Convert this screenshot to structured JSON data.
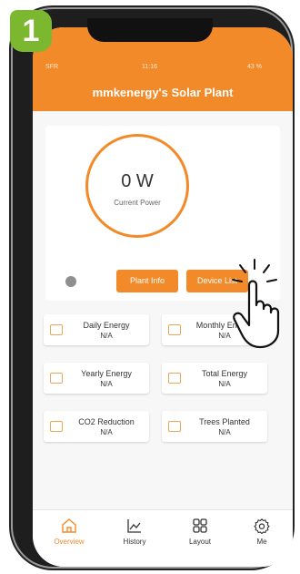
{
  "step_number": "1",
  "status_bar": {
    "carrier": "SFR",
    "time": "11:16",
    "battery": "43 %"
  },
  "app": {
    "title": "mmkenergy's Solar Plant"
  },
  "power": {
    "value": "0 W",
    "label": "Current Power"
  },
  "buttons": {
    "plant_info": "Plant Info",
    "device_list": "Device List"
  },
  "stats": [
    {
      "label": "Daily Energy",
      "value": "N/A",
      "icon": "calendar-icon"
    },
    {
      "label": "Monthly Energy",
      "value": "N/A",
      "icon": "calendar-month-icon"
    },
    {
      "label": "Yearly Energy",
      "value": "N/A",
      "icon": "bar-chart-icon"
    },
    {
      "label": "Total Energy",
      "value": "N/A",
      "icon": "line-chart-icon"
    },
    {
      "label": "CO2 Reduction",
      "value": "N/A",
      "icon": "car-icon"
    },
    {
      "label": "Trees Planted",
      "value": "N/A",
      "icon": "trees-icon"
    }
  ],
  "nav": [
    {
      "label": "Overview",
      "icon": "home-icon",
      "active": true
    },
    {
      "label": "History",
      "icon": "chart-icon",
      "active": false
    },
    {
      "label": "Layout",
      "icon": "grid-icon",
      "active": false
    },
    {
      "label": "Me",
      "icon": "gear-icon",
      "active": false
    }
  ],
  "colors": {
    "accent": "#f28a2a",
    "badge": "#7cb82f",
    "status_dot": "#8e8e8e"
  }
}
